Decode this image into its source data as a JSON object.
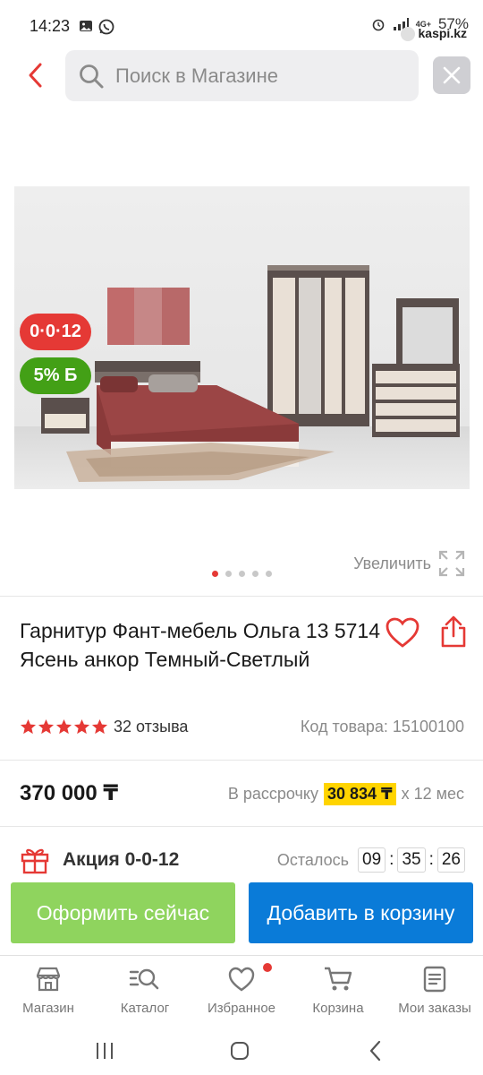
{
  "status_bar": {
    "time": "14:23",
    "network": "4G+",
    "battery": "57%"
  },
  "watermark": "kaspi.kz",
  "search": {
    "placeholder": "Поиск в Магазине"
  },
  "product": {
    "badge_credit": "0·0·12",
    "badge_bonus": "5% Б",
    "zoom_label": "Увеличить",
    "gallery_count": 5,
    "gallery_active_index": 0,
    "title": "Гарнитур Фант-мебель Ольга 13 5714 Ясень анкор Темный-Светлый",
    "rating_stars": 5,
    "reviews": "32 отзыва",
    "sku": "Код товара: 15100100",
    "price": "370 000 ₸",
    "installment_prefix": "В рассрочку",
    "installment_amount": "30 834 ₸",
    "installment_suffix": "x 12 мес",
    "promo_label": "Акция 0-0-12",
    "timer_label": "Осталось",
    "timer_h": "09",
    "timer_m": "35",
    "timer_s": "26"
  },
  "actions": {
    "buy_now": "Оформить сейчас",
    "add_to_cart": "Добавить в корзину"
  },
  "tabbar": {
    "items": [
      {
        "label": "Магазин",
        "icon": "store-icon"
      },
      {
        "label": "Каталог",
        "icon": "catalog-search-icon"
      },
      {
        "label": "Избранное",
        "icon": "heart-icon"
      },
      {
        "label": "Корзина",
        "icon": "cart-icon"
      },
      {
        "label": "Мои заказы",
        "icon": "orders-icon"
      }
    ]
  },
  "colors": {
    "accent_red": "#e53935",
    "bonus_green": "#43a016",
    "buy_green": "#8fd45e",
    "cart_blue": "#0a7bd8",
    "installment_yellow": "#ffd400"
  }
}
